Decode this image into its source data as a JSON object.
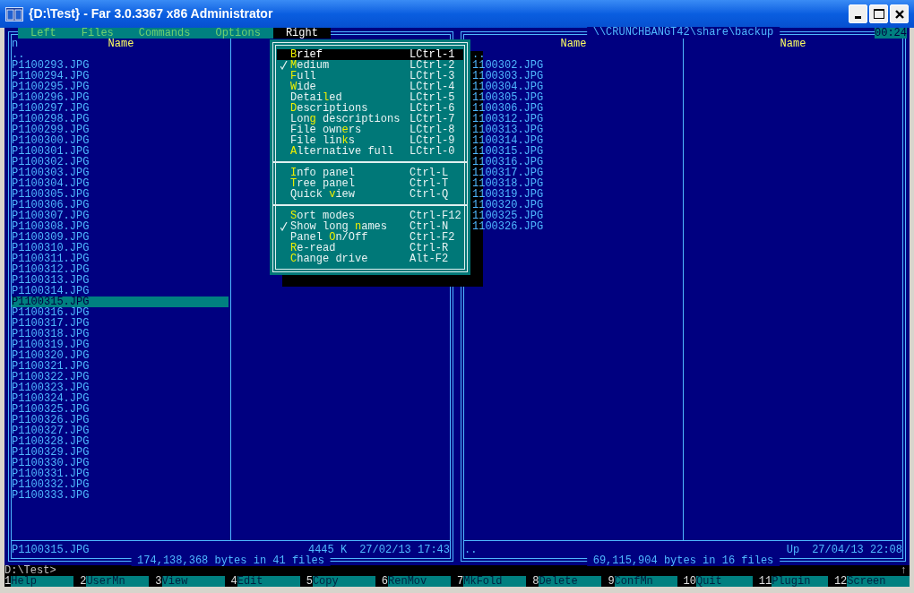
{
  "window": {
    "title": "{D:\\Test} - Far 3.0.3367 x86 Administrator"
  },
  "menu_bar": [
    {
      "label": "**L**eft",
      "selected": false
    },
    {
      "label": "**F**iles",
      "selected": false
    },
    {
      "label": "**C**ommands",
      "selected": false
    },
    {
      "label": "**O**ptions",
      "selected": false
    },
    {
      "label": "**R**ight",
      "selected": true
    }
  ],
  "clock": "00:24",
  "panels": [
    {
      "sort_indicator": "n",
      "columns": [
        {
          "header": "Name",
          "files": [
            {
              "name": "..",
              "selected": false
            },
            {
              "name": "P1100293.JPG",
              "selected": false
            },
            {
              "name": "P1100294.JPG",
              "selected": false
            },
            {
              "name": "P1100295.JPG",
              "selected": false
            },
            {
              "name": "P1100296.JPG",
              "selected": false
            },
            {
              "name": "P1100297.JPG",
              "selected": false
            },
            {
              "name": "P1100298.JPG",
              "selected": false
            },
            {
              "name": "P1100299.JPG",
              "selected": false
            },
            {
              "name": "P1100300.JPG",
              "selected": false
            },
            {
              "name": "P1100301.JPG",
              "selected": false
            },
            {
              "name": "P1100302.JPG",
              "selected": false
            },
            {
              "name": "P1100303.JPG",
              "selected": false
            },
            {
              "name": "P1100304.JPG",
              "selected": false
            },
            {
              "name": "P1100305.JPG",
              "selected": false
            },
            {
              "name": "P1100306.JPG",
              "selected": false
            },
            {
              "name": "P1100307.JPG",
              "selected": false
            },
            {
              "name": "P1100308.JPG",
              "selected": false
            },
            {
              "name": "P1100309.JPG",
              "selected": false
            },
            {
              "name": "P1100310.JPG",
              "selected": false
            },
            {
              "name": "P1100311.JPG",
              "selected": false
            },
            {
              "name": "P1100312.JPG",
              "selected": false
            },
            {
              "name": "P1100313.JPG",
              "selected": false
            },
            {
              "name": "P1100314.JPG",
              "selected": false
            },
            {
              "name": "P1100315.JPG",
              "selected": true
            },
            {
              "name": "P1100316.JPG",
              "selected": false
            },
            {
              "name": "P1100317.JPG",
              "selected": false
            },
            {
              "name": "P1100318.JPG",
              "selected": false
            },
            {
              "name": "P1100319.JPG",
              "selected": false
            },
            {
              "name": "P1100320.JPG",
              "selected": false
            },
            {
              "name": "P1100321.JPG",
              "selected": false
            },
            {
              "name": "P1100322.JPG",
              "selected": false
            },
            {
              "name": "P1100323.JPG",
              "selected": false
            },
            {
              "name": "P1100324.JPG",
              "selected": false
            },
            {
              "name": "P1100325.JPG",
              "selected": false
            },
            {
              "name": "P1100326.JPG",
              "selected": false
            },
            {
              "name": "P1100327.JPG",
              "selected": false
            },
            {
              "name": "P1100328.JPG",
              "selected": false
            },
            {
              "name": "P1100329.JPG",
              "selected": false
            },
            {
              "name": "P1100330.JPG",
              "selected": false
            },
            {
              "name": "P1100331.JPG",
              "selected": false
            },
            {
              "name": "P1100332.JPG",
              "selected": false
            },
            {
              "name": "P1100333.JPG",
              "selected": false
            }
          ]
        },
        {}
      ],
      "footer": {
        "name": "P1100315.JPG",
        "size": "4445 K",
        "date": "27/02/13 17:43"
      },
      "totals": "174,138,368 bytes in 41 files"
    },
    {
      "title": "\\\\CRUNCHBANGT42\\share\\backup",
      "columns": [
        {
          "header": "Name",
          "files": [
            {
              "name": "..",
              "selected": false
            },
            {
              "name": "1100302.JPG",
              "selected": false
            },
            {
              "name": "1100303.JPG",
              "selected": false
            },
            {
              "name": "1100304.JPG",
              "selected": false
            },
            {
              "name": "1100305.JPG",
              "selected": false
            },
            {
              "name": "1100306.JPG",
              "selected": false
            },
            {
              "name": "1100312.JPG",
              "selected": false
            },
            {
              "name": "1100313.JPG",
              "selected": false
            },
            {
              "name": "1100314.JPG",
              "selected": false
            },
            {
              "name": "1100315.JPG",
              "selected": false
            },
            {
              "name": "1100316.JPG",
              "selected": false
            },
            {
              "name": "1100317.JPG",
              "selected": false
            },
            {
              "name": "1100318.JPG",
              "selected": false
            },
            {
              "name": "1100319.JPG",
              "selected": false
            },
            {
              "name": "1100320.JPG",
              "selected": false
            },
            {
              "name": "1100325.JPG",
              "selected": false
            },
            {
              "name": "1100326.JPG",
              "selected": false
            }
          ]
        },
        {
          "header": "Name"
        }
      ],
      "footer": {
        "name": "..",
        "size": "Up",
        "date": "27/04/13 22:08"
      },
      "totals": "69,115,904 bytes in 16 files"
    }
  ],
  "menu": {
    "items": [
      {
        "kind": "item",
        "label": "**B**rief",
        "shortcut": "LCtrl-1",
        "checked": false,
        "selected": true
      },
      {
        "kind": "item",
        "label": "**M**edium",
        "shortcut": "LCtrl-2",
        "checked": true,
        "selected": false
      },
      {
        "kind": "item",
        "label": "**F**ull",
        "shortcut": "LCtrl-3",
        "checked": false,
        "selected": false
      },
      {
        "kind": "item",
        "label": "**W**ide",
        "shortcut": "LCtrl-4",
        "checked": false,
        "selected": false
      },
      {
        "kind": "item",
        "label": "Detai**l**ed",
        "shortcut": "LCtrl-5",
        "checked": false,
        "selected": false
      },
      {
        "kind": "item",
        "label": "**D**escriptions",
        "shortcut": "LCtrl-6",
        "checked": false,
        "selected": false
      },
      {
        "kind": "item",
        "label": "Lon**g** descriptions",
        "shortcut": "LCtrl-7",
        "checked": false,
        "selected": false
      },
      {
        "kind": "item",
        "label": "File own**e**rs",
        "shortcut": "LCtrl-8",
        "checked": false,
        "selected": false
      },
      {
        "kind": "item",
        "label": "File lin**k**s",
        "shortcut": "LCtrl-9",
        "checked": false,
        "selected": false
      },
      {
        "kind": "item",
        "label": "**A**lternative full",
        "shortcut": "LCtrl-0",
        "checked": false,
        "selected": false
      },
      {
        "kind": "separator"
      },
      {
        "kind": "item",
        "label": "**I**nfo panel",
        "shortcut": "Ctrl-L",
        "checked": false,
        "selected": false
      },
      {
        "kind": "item",
        "label": "**T**ree panel",
        "shortcut": "Ctrl-T",
        "checked": false,
        "selected": false
      },
      {
        "kind": "item",
        "label": "Quick **v**iew",
        "shortcut": "Ctrl-Q",
        "checked": false,
        "selected": false
      },
      {
        "kind": "separator"
      },
      {
        "kind": "item",
        "label": "**S**ort modes",
        "shortcut": "Ctrl-F12",
        "checked": false,
        "selected": false
      },
      {
        "kind": "item",
        "label": "Show long **n**ames",
        "shortcut": "Ctrl-N",
        "checked": true,
        "selected": false
      },
      {
        "kind": "item",
        "label": "Panel **O**n/Off",
        "shortcut": "Ctrl-F2",
        "checked": false,
        "selected": false
      },
      {
        "kind": "item",
        "label": "**R**e-read",
        "shortcut": "Ctrl-R",
        "checked": false,
        "selected": false
      },
      {
        "kind": "item",
        "label": "**C**hange drive",
        "shortcut": "Alt-F2",
        "checked": false,
        "selected": false
      }
    ]
  },
  "command_line": {
    "prompt": "D:\\Test>",
    "indicator": "↑"
  },
  "key_bar": [
    {
      "num": "1",
      "label": "Help"
    },
    {
      "num": "2",
      "label": "UserMn"
    },
    {
      "num": "3",
      "label": "View"
    },
    {
      "num": "4",
      "label": "Edit"
    },
    {
      "num": "5",
      "label": "Copy"
    },
    {
      "num": "6",
      "label": "RenMov"
    },
    {
      "num": "7",
      "label": "MkFold"
    },
    {
      "num": "8",
      "label": "Delete"
    },
    {
      "num": "9",
      "label": "ConfMn"
    },
    {
      "num": "10",
      "label": "Quit"
    },
    {
      "num": "11",
      "label": "Plugin"
    },
    {
      "num": "12",
      "label": "Screen"
    }
  ]
}
